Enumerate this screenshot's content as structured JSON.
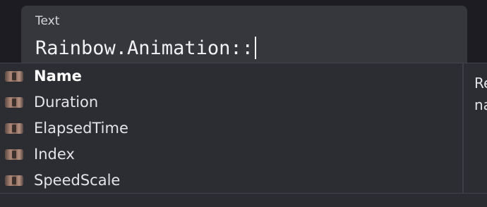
{
  "text_field": {
    "label": "Text",
    "value": "Rainbow.Animation::"
  },
  "autocomplete": {
    "selected_index": 0,
    "items": [
      {
        "label": "Name",
        "icon": "property-icon"
      },
      {
        "label": "Duration",
        "icon": "property-icon"
      },
      {
        "label": "ElapsedTime",
        "icon": "property-icon"
      },
      {
        "label": "Index",
        "icon": "property-icon"
      },
      {
        "label": "SpeedScale",
        "icon": "property-icon"
      }
    ],
    "detail_lines": [
      "Re",
      "na"
    ]
  },
  "colors": {
    "background": "#1c1c22",
    "field_background": "#36373d",
    "dropdown_background": "#2c2d33",
    "text": "#e4e4e8"
  }
}
